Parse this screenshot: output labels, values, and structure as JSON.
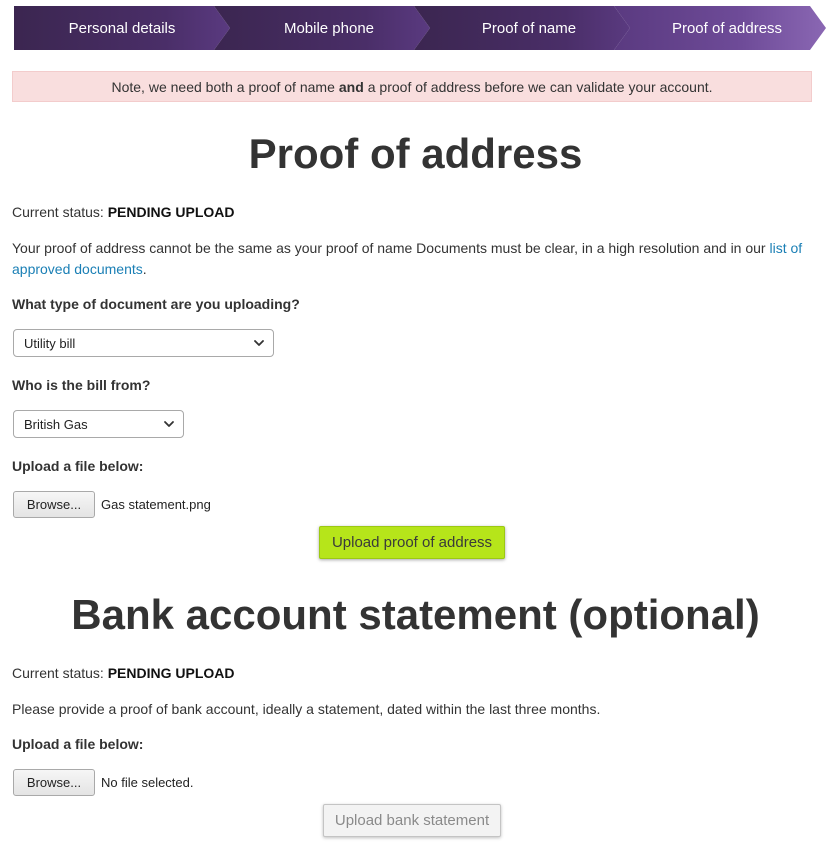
{
  "steps": [
    {
      "label": "Personal details"
    },
    {
      "label": "Mobile phone"
    },
    {
      "label": "Proof of name"
    },
    {
      "label": "Proof of address"
    }
  ],
  "note": {
    "before": "Note, we need both a proof of name",
    "bold": "and",
    "after": "a proof of address before we can validate your account."
  },
  "address": {
    "title": "Proof of address",
    "status_label": "Current status:",
    "status_value": "PENDING UPLOAD",
    "description": "Your proof of address cannot be the same as your proof of name Documents must be clear, in a high resolution and in our",
    "link_text": "list of approved documents",
    "description_end": ".",
    "doc_type_label": "What type of document are you uploading?",
    "doc_type_value": "Utility bill",
    "bill_from_label": "Who is the bill from?",
    "bill_from_value": "British Gas",
    "upload_label": "Upload a file below:",
    "browse_label": "Browse...",
    "file_name": "Gas statement.png",
    "upload_button": "Upload proof of address"
  },
  "bank": {
    "title": "Bank account statement (optional)",
    "status_label": "Current status:",
    "status_value": "PENDING UPLOAD",
    "description": "Please provide a proof of bank account, ideally a statement, dated within the last three months.",
    "upload_label": "Upload a file below:",
    "browse_label": "Browse...",
    "file_name": "No file selected.",
    "upload_button": "Upload bank statement"
  },
  "icons": {
    "select_arrow": "chevron-down-icon"
  },
  "colors": {
    "step_dark": "#4a2e68",
    "step_active": "#6e4b98",
    "note_bg": "#f9dede",
    "link": "#1a7fb5",
    "upload_primary": "#b6e51a",
    "upload_disabled": "#f3f3f3"
  }
}
